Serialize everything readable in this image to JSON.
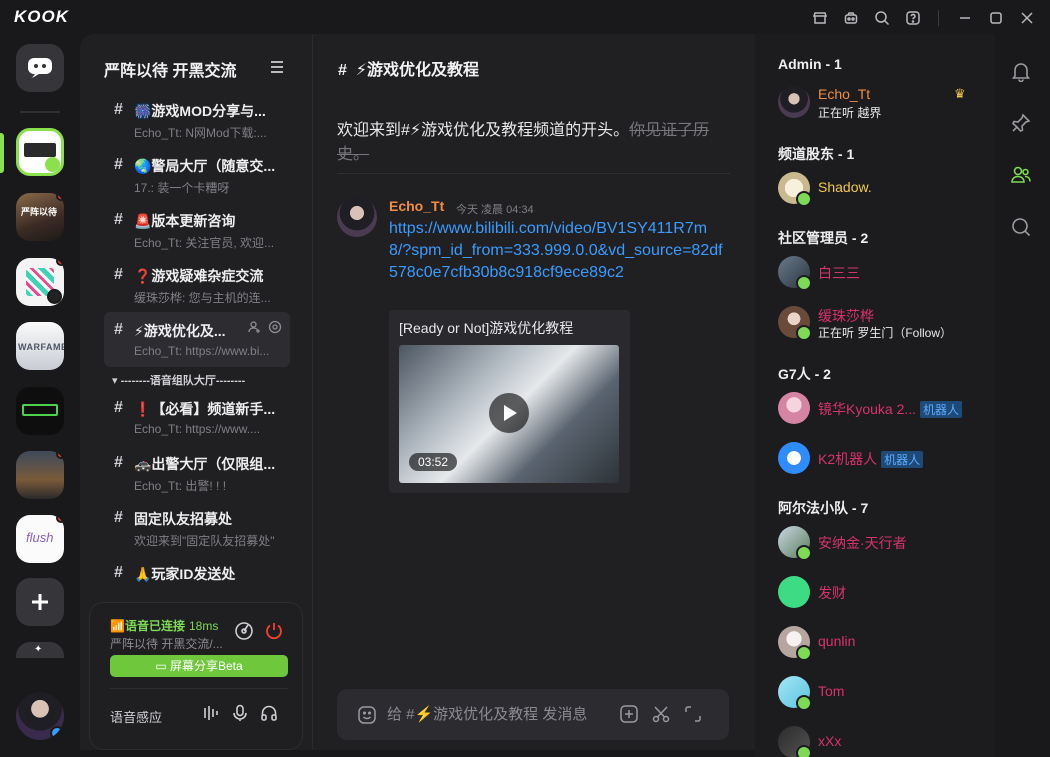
{
  "app": {
    "logo": "KOOK"
  },
  "guild": {
    "title": "严阵以待 开黑交流"
  },
  "channels": [
    {
      "name": "🎆游戏MOD分享与...",
      "sub": "Echo_Tt: N网Mod下载:..."
    },
    {
      "name": "🌏警局大厅（随意交...",
      "sub": "17.: 装一个卡糟呀"
    },
    {
      "name": "🚨版本更新咨询",
      "sub": "Echo_Tt: 关注官员, 欢迎..."
    },
    {
      "name": "❓游戏疑难杂症交流",
      "sub": "缓珠莎桦: 您与主机的连..."
    },
    {
      "name": "⚡游戏优化及...",
      "sub": "Echo_Tt: https://www.bi..."
    }
  ],
  "voice_category": "--------语音组队大厅--------",
  "channels2": [
    {
      "name": "❗【必看】频道新手...",
      "sub": "Echo_Tt: https://www...."
    },
    {
      "name": "🚓出警大厅（仅限组...",
      "sub": "Echo_Tt: 出警! ! !"
    },
    {
      "name": "固定队友招募处",
      "sub": "欢迎来到\"固定队友招募处\""
    },
    {
      "name": "🙏玩家ID发送处",
      "sub": ""
    }
  ],
  "voice": {
    "status": "语音已连接",
    "ping": "18ms",
    "channel": "严阵以待 开黑交流/...",
    "share": "屏幕分享Beta",
    "mode": "语音感应"
  },
  "chat": {
    "header": "⚡游戏优化及教程",
    "welcome": "欢迎来到#⚡游戏优化及教程频道的开头。",
    "welcome_history": "你见证了历史。",
    "message": {
      "author": "Echo_Tt",
      "time": "今天 凌晨 04:34",
      "link": "https://www.bilibili.com/video/BV1SY411R7m8/?spm_id_from=333.999.0.0&vd_source=82df578c0e7cfb30b8c918cf9ece89c2",
      "embed_title": "[Ready or Not]游戏优化教程",
      "duration": "03:52"
    },
    "placeholder": "给 #⚡游戏优化及教程 发消息"
  },
  "members": {
    "roles": [
      {
        "label": "Admin - 1"
      },
      {
        "label": "频道股东 - 1"
      },
      {
        "label": "社区管理员 - 2"
      },
      {
        "label": "G7人 - 2"
      },
      {
        "label": "阿尔法小队 - 7"
      }
    ],
    "list": [
      {
        "name": "Echo_Tt",
        "status": "正在听 越界",
        "color": "#f08e40"
      },
      {
        "name": "Shadow.",
        "status": "",
        "color": "#f2c94c"
      },
      {
        "name": "白三三",
        "status": "",
        "color": "#d6336c"
      },
      {
        "name": "缓珠莎桦",
        "status": "正在听 罗生门（Follow）",
        "color": "#d6336c"
      },
      {
        "name": "镜华Kyouka 2...",
        "status": "",
        "color": "#d6336c",
        "badge": "机器人"
      },
      {
        "name": "K2机器人",
        "status": "",
        "color": "#d6336c",
        "badge": "机器人"
      },
      {
        "name": "安纳金·天行者",
        "status": "",
        "color": "#d6336c"
      },
      {
        "name": "发财",
        "status": "",
        "color": "#d6336c"
      },
      {
        "name": "qunlin",
        "status": "",
        "color": "#d6336c"
      },
      {
        "name": "Tom",
        "status": "",
        "color": "#d6336c"
      },
      {
        "name": "xXx",
        "status": "",
        "color": "#d6336c"
      }
    ]
  },
  "colors": {
    "accent": "#7ed957",
    "link": "#3a9cff",
    "badge_dot": "#f5412f"
  }
}
